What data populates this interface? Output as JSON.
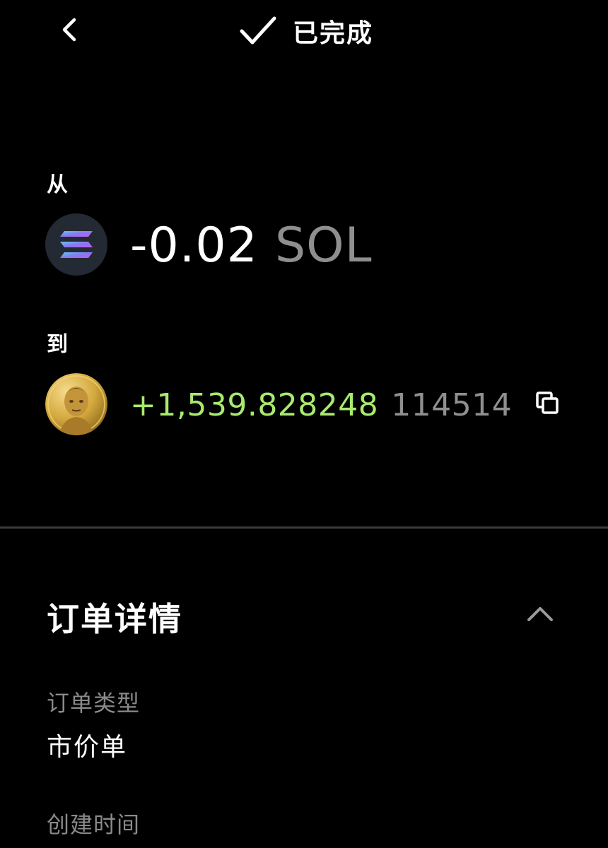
{
  "header": {
    "status_text": "已完成",
    "icons": {
      "back": "chevron-left-icon",
      "status": "check-icon"
    }
  },
  "from": {
    "label": "从",
    "amount": "-0.02",
    "unit": "SOL",
    "coin_icon": "solana-coin-icon"
  },
  "to": {
    "label": "到",
    "amount": "+1,539.828248",
    "unit": "114514",
    "coin_icon": "token-portrait-coin-icon",
    "copy_icon": "copy-icon"
  },
  "order_details": {
    "title": "订单详情",
    "collapse_icon": "chevron-up-icon",
    "fields": [
      {
        "label": "订单类型",
        "value": "市价单"
      },
      {
        "label": "创建时间",
        "value": ""
      }
    ]
  },
  "colors": {
    "background": "#000000",
    "positive": "#a8ea6e",
    "muted": "#8f8f8f",
    "divider": "#3a3a3a"
  }
}
